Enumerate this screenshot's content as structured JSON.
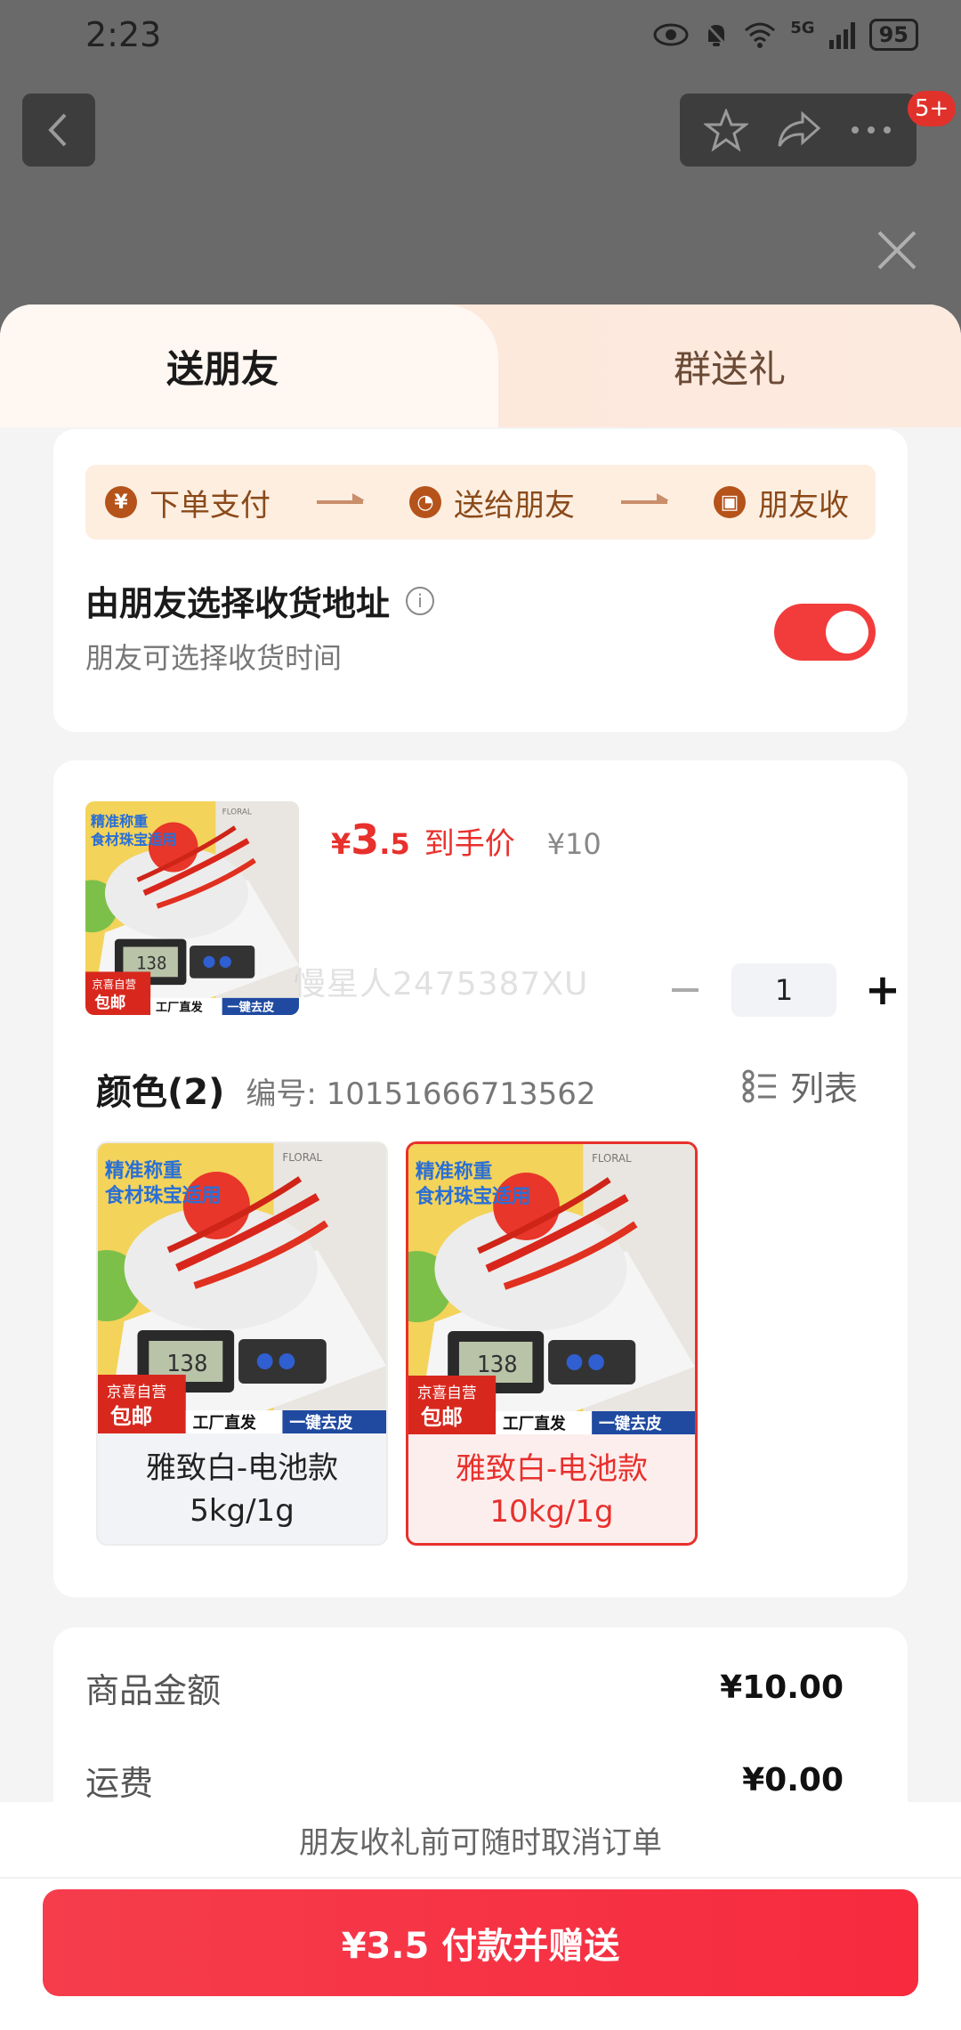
{
  "status_bar": {
    "time": "2:23",
    "network": "5G",
    "battery": "95"
  },
  "top_bar": {
    "badge": "5+"
  },
  "tabs": {
    "active": "送朋友",
    "inactive": "群送礼"
  },
  "steps": [
    {
      "icon_text": "¥",
      "label": "下单支付"
    },
    {
      "icon_text": "◔",
      "label": "送给朋友"
    },
    {
      "icon_text": "▣",
      "label": "朋友收"
    }
  ],
  "address": {
    "title": "由朋友选择收货地址",
    "subtitle": "朋友可选择收货时间",
    "toggle_on": true
  },
  "product": {
    "price_symbol": "¥",
    "price_int": "3",
    "price_dec": ".5",
    "price_tag": "到手价",
    "original_price": "¥10",
    "watermark": "慢星人2475387XU",
    "quantity": "1"
  },
  "color": {
    "title": "颜色(2)",
    "sku": "编号: 10151666713562",
    "list_label": "列表",
    "variants": [
      {
        "line1": "雅致白-电池款",
        "line2": "5kg/1g",
        "selected": false
      },
      {
        "line1": "雅致白-电池款",
        "line2": "10kg/1g",
        "selected": true
      }
    ]
  },
  "thumb_text": {
    "top_tag_1": "精准称重",
    "top_tag_2": "食材珠宝适用",
    "self_op": "京喜自营",
    "free_ship": "包邮",
    "factory": "工厂直发",
    "tare": "一键去皮",
    "lcd": "138",
    "brand": "FLORAL"
  },
  "amounts": [
    {
      "label": "商品金额",
      "value": "¥10.00"
    },
    {
      "label": "运费",
      "value": "¥0.00"
    }
  ],
  "bottom": {
    "note": "朋友收礼前可随时取消订单",
    "pay_label": "¥3.5 付款并赠送"
  },
  "colors": {
    "accent": "#e8302c",
    "tab_bg": "#fde6d9",
    "step_bg": "#fdeee0"
  }
}
